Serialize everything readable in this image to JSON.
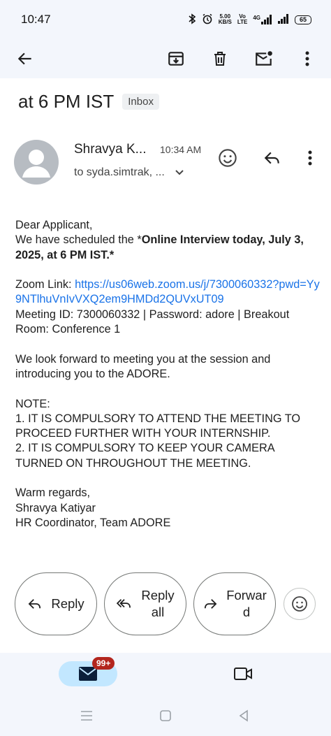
{
  "status_bar": {
    "time": "10:47",
    "net_speed_value": "5.00",
    "net_speed_unit": "KB/S",
    "volte_top": "Vo",
    "volte_bottom": "LTE",
    "signal_label": "4G",
    "battery": "65"
  },
  "email": {
    "subject": "at 6 PM IST",
    "label_chip": "Inbox",
    "sender": "Shravya K...",
    "time": "10:34 AM",
    "recipient": "to syda.simtrak, ...",
    "body": {
      "greeting": "Dear Applicant,",
      "schedule_prefix": "We have scheduled the *",
      "schedule_bold": "Online Interview today, July 3, 2025, at 6 PM IST.*",
      "zoom_label": "Zoom Link: ",
      "zoom_url": "https://us06web.zoom.us/j/7300060332?pwd=Yy9NTlhuVnIvVXQ2em9HMDd2QUVxUT09",
      "meeting_info": "Meeting ID: 7300060332 | Password: adore | Breakout Room: Conference 1",
      "look_forward": "We look forward to meeting you at the session and introducing you to the ADORE.",
      "note_title": "NOTE:",
      "note_1": "1. IT IS COMPULSORY TO ATTEND THE MEETING TO PROCEED FURTHER WITH YOUR INTERNSHIP.",
      "note_2": "2. IT IS COMPULSORY TO KEEP YOUR CAMERA TURNED ON THROUGHOUT THE MEETING.",
      "signoff": "Warm regards,",
      "signer_name": "Shravya Katiyar",
      "signer_title": "HR Coordinator, Team ADORE"
    }
  },
  "actions": {
    "reply": "Reply",
    "reply_all_line1": "Reply",
    "reply_all_line2": "all",
    "forward_line1": "Forwar",
    "forward_line2": "d"
  },
  "bottom_nav": {
    "mail_badge": "99+"
  },
  "icons": {
    "back": "arrow-back-icon",
    "archive": "archive-icon",
    "delete": "trash-icon",
    "mark_unread": "mail-unread-icon",
    "more": "more-vert-icon",
    "emoji": "emoji-icon",
    "reply": "reply-icon",
    "reply_all": "reply-all-icon",
    "forward": "forward-icon",
    "mail_tab": "mail-icon",
    "meet_tab": "video-icon"
  },
  "colors": {
    "link": "#1a73e8",
    "badge": "#b3261e",
    "mail_pill": "#c2e7ff"
  }
}
